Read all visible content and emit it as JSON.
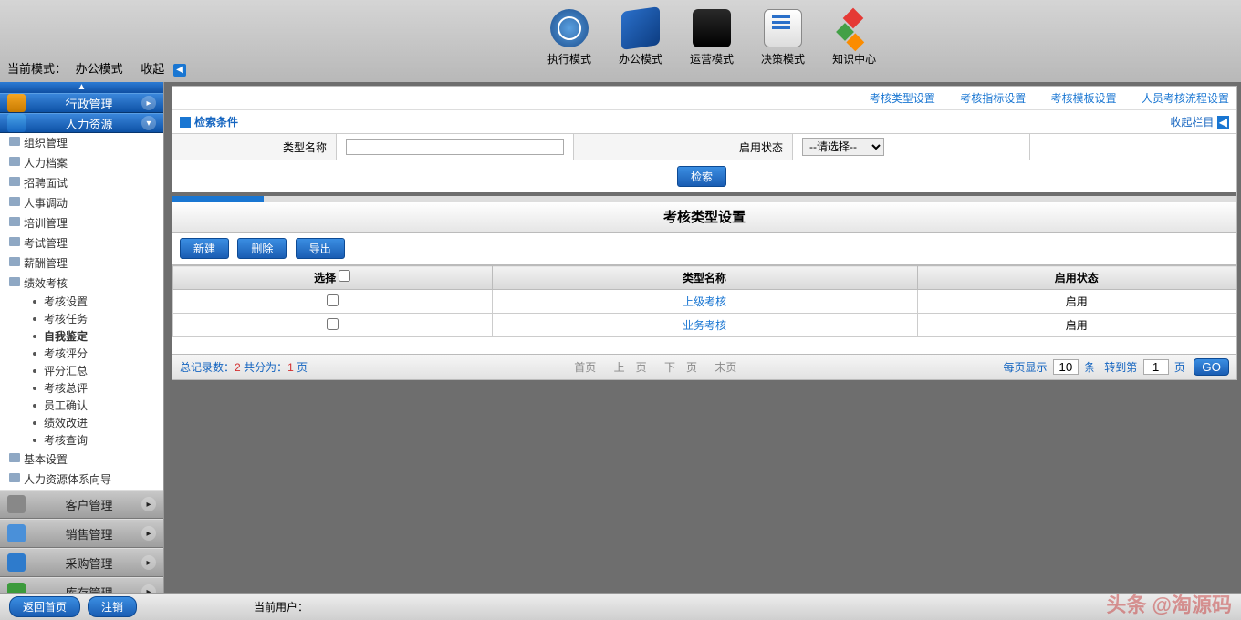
{
  "header": {
    "current_mode_label": "当前模式：",
    "current_mode_value": "办公模式",
    "collapse": "收起",
    "nav": [
      "执行模式",
      "办公模式",
      "运营模式",
      "决策模式",
      "知识中心"
    ]
  },
  "sidebar": {
    "sections": {
      "admin": "行政管理",
      "hr": "人力资源",
      "customer": "客户管理",
      "sales": "销售管理",
      "purchase": "采购管理",
      "stock": "库存管理"
    },
    "hr_tree": {
      "l1": [
        "组织管理",
        "人力档案",
        "招聘面试",
        "人事调动",
        "培训管理",
        "考试管理",
        "薪酬管理",
        "绩效考核",
        "基本设置",
        "人力资源体系向导"
      ],
      "perf_children": [
        "考核设置",
        "考核任务",
        "自我鉴定",
        "考核评分",
        "评分汇总",
        "考核总评",
        "员工确认",
        "绩效改进",
        "考核查询"
      ]
    }
  },
  "main": {
    "top_links": [
      "考核类型设置",
      "考核指标设置",
      "考核模板设置",
      "人员考核流程设置"
    ],
    "search": {
      "header": "检索条件",
      "collapse_column": "收起栏目",
      "type_name_label": "类型名称",
      "status_label": "启用状态",
      "status_placeholder": "--请选择--",
      "search_btn": "检索"
    },
    "title": "考核类型设置",
    "toolbar": {
      "new": "新建",
      "delete": "删除",
      "export": "导出"
    },
    "table": {
      "headers": {
        "select": "选择",
        "name": "类型名称",
        "status": "启用状态"
      },
      "rows": [
        {
          "name": "上级考核",
          "status": "启用"
        },
        {
          "name": "业务考核",
          "status": "启用"
        }
      ]
    },
    "pager": {
      "total_label": "总记录数：",
      "total": "2",
      "pages_label": " 共分为：",
      "pages": "1",
      "pages_suffix": " 页",
      "first": "首页",
      "prev": "上一页",
      "next": "下一页",
      "last": "末页",
      "per_page_label": "每页显示",
      "per_page": "10",
      "per_page_suffix": "条",
      "goto_label": "转到第",
      "goto": "1",
      "goto_suffix": "页",
      "go": "GO"
    }
  },
  "footer": {
    "home": "返回首页",
    "logout": "注销",
    "current_user_label": "当前用户：",
    "watermark": "头条 @淘源码"
  }
}
